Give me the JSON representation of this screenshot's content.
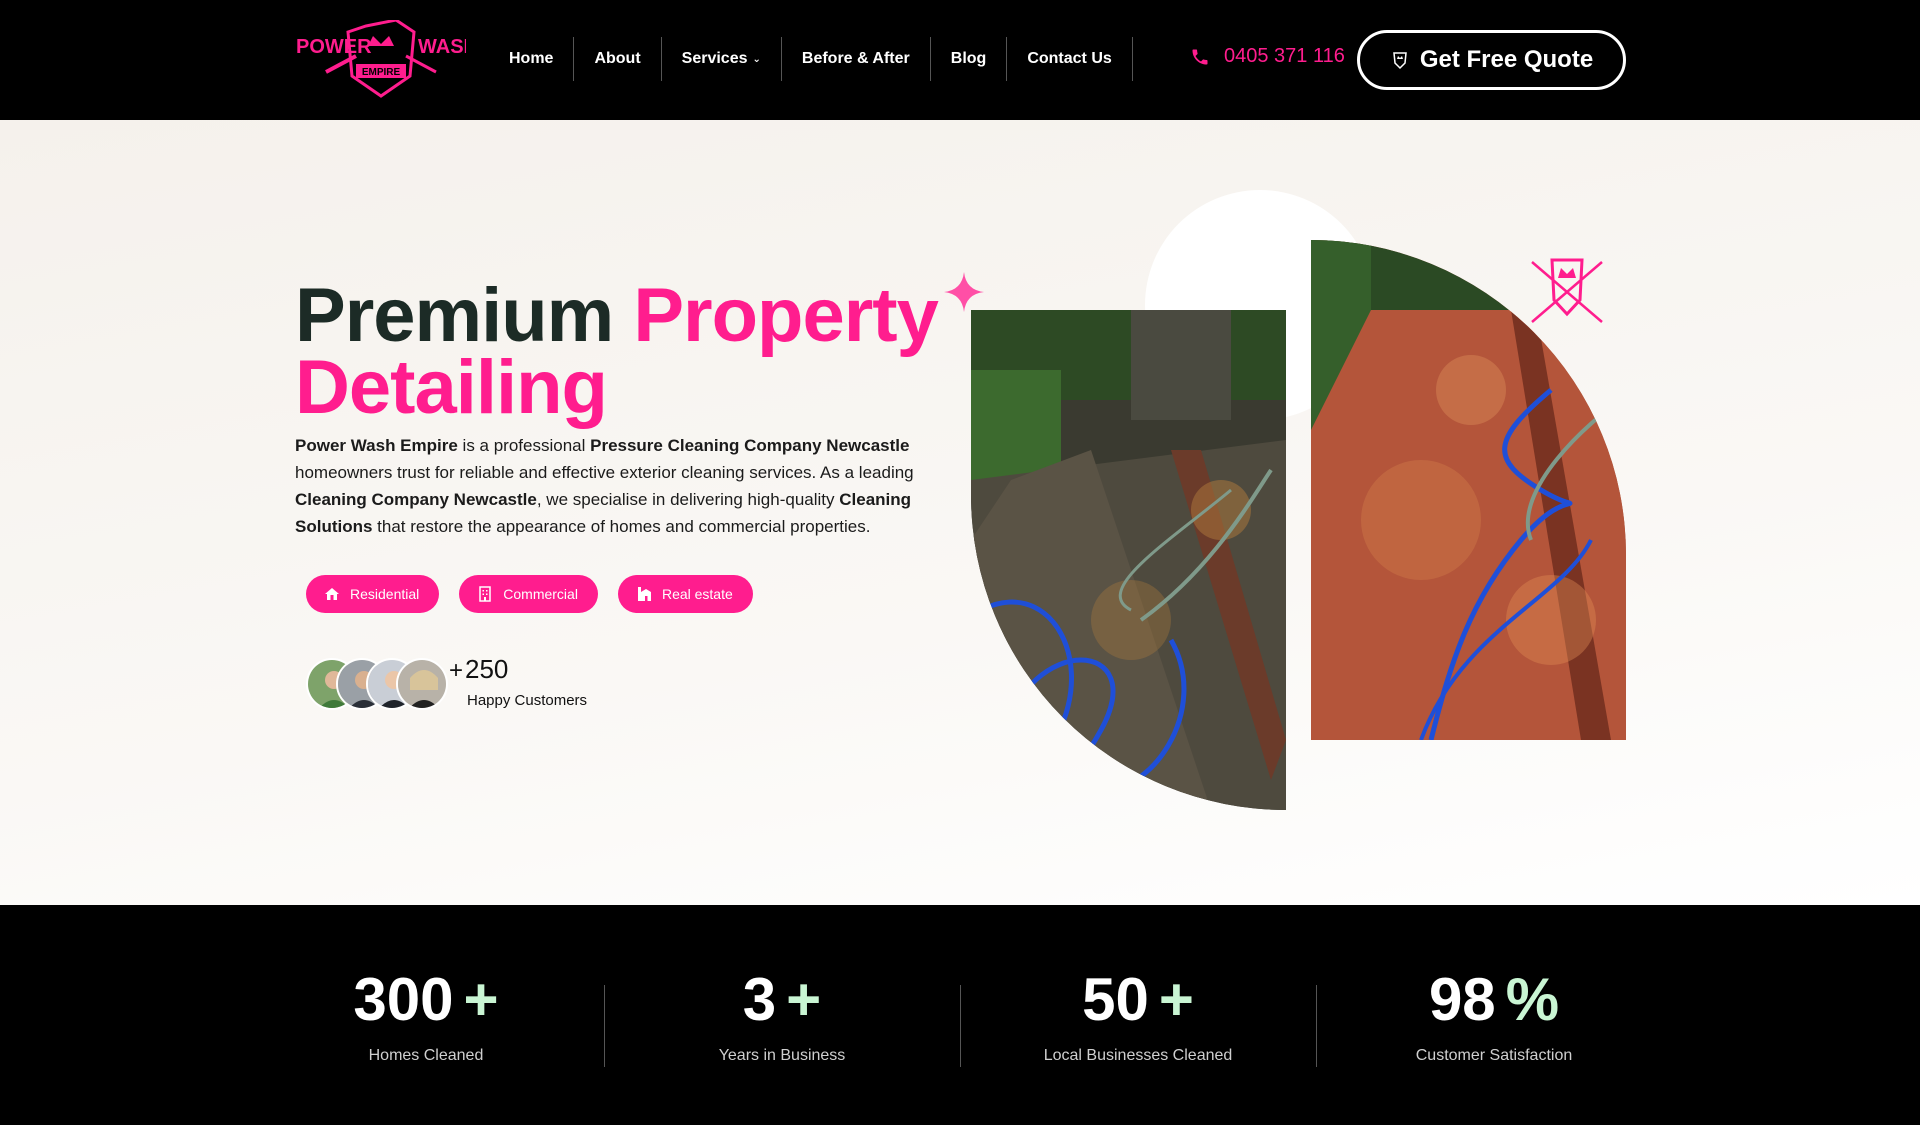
{
  "header": {
    "logo": {
      "text_left": "POWER",
      "text_right": "WASH",
      "text_bottom": "EMPIRE"
    },
    "nav": [
      {
        "label": "Home"
      },
      {
        "label": "About"
      },
      {
        "label": "Services"
      },
      {
        "label": "Before & After"
      },
      {
        "label": "Blog"
      },
      {
        "label": "Contact Us"
      }
    ],
    "phone": "0405 371 116",
    "cta": "Get Free Quote"
  },
  "hero": {
    "title_dark": "Premium ",
    "title_pink_1": "Property",
    "title_pink_2": "Detailing",
    "desc": {
      "b1": "Power Wash Empire",
      "t1": " is a professional ",
      "b2": "Pressure Cleaning Company Newcastle",
      "t2": " homeowners trust for reliable and effective exterior cleaning services. As a leading ",
      "b3": "Cleaning Company Newcastle",
      "t3": ", we specialise in delivering high-quality ",
      "b4": "Cleaning Solutions",
      "t4": " that restore the appearance of homes and commercial properties."
    },
    "chips": [
      {
        "label": "Residential",
        "icon": "house-icon"
      },
      {
        "label": "Commercial",
        "icon": "building-icon"
      },
      {
        "label": "Real estate",
        "icon": "real-estate-icon"
      }
    ],
    "customers": {
      "plus": "+",
      "count": "250",
      "label": "Happy Customers"
    }
  },
  "stats": [
    {
      "value": "300",
      "suffix": "+",
      "label": "Homes Cleaned"
    },
    {
      "value": "3",
      "suffix": "+",
      "label": "Years in Business"
    },
    {
      "value": "50",
      "suffix": "+",
      "label": "Local Businesses Cleaned"
    },
    {
      "value": "98",
      "suffix": "%",
      "label": "Customer Satisfaction"
    }
  ],
  "colors": {
    "accent": "#ff1d8e",
    "dark": "#1c2b26",
    "stat_suffix": "#c9f5d3"
  }
}
